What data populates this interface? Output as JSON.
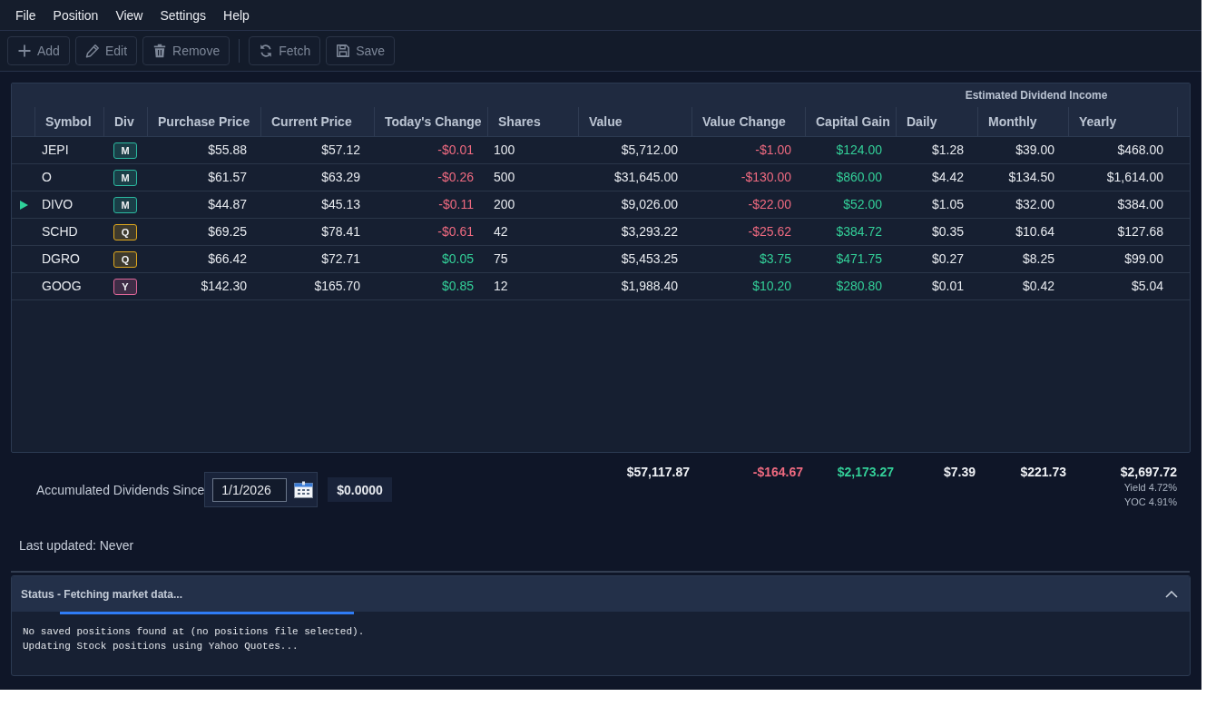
{
  "menu": [
    {
      "label": "File"
    },
    {
      "label": "Position"
    },
    {
      "label": "View"
    },
    {
      "label": "Settings"
    },
    {
      "label": "Help"
    }
  ],
  "toolbar": {
    "groups": [
      {
        "buttons": [
          {
            "label": "Add",
            "disabled": true
          },
          {
            "label": "Edit",
            "disabled": true
          },
          {
            "label": "Remove",
            "disabled": true
          }
        ]
      },
      {
        "buttons": [
          {
            "label": "Fetch",
            "disabled": true
          },
          {
            "label": "Save",
            "disabled": true
          }
        ]
      }
    ]
  },
  "table": {
    "group_header": "Estimated Dividend Income",
    "columns": [
      "Symbol",
      "Div",
      "Purchase Price",
      "Current Price",
      "Today's Change",
      "Shares",
      "Value",
      "Value Change",
      "Capital Gain",
      "Daily",
      "Monthly",
      "Yearly"
    ],
    "rows": [
      {
        "selected": false,
        "cells": [
          {
            "text": "JEPI",
            "color": "#e6e9ee"
          },
          {
            "text": "M",
            "color": "#2bb9a0"
          },
          {
            "text": "$55.88",
            "color": "#e6e9ee"
          },
          {
            "text": "$57.12",
            "color": "#e6e9ee"
          },
          {
            "text": "-$0.01",
            "color": "#ef6a80"
          },
          {
            "text": "100",
            "color": "#e6e9ee"
          },
          {
            "text": "$5,712.00",
            "color": "#e6e9ee"
          },
          {
            "text": "-$1.00",
            "color": "#ef6a80"
          },
          {
            "text": "$124.00",
            "color": "#33cf98"
          },
          {
            "text": "$1.28",
            "color": "#e6e9ee"
          },
          {
            "text": "$39.00",
            "color": "#e6e9ee"
          },
          {
            "text": "$468.00",
            "color": "#e6e9ee"
          }
        ]
      },
      {
        "selected": false,
        "cells": [
          {
            "text": "O",
            "color": "#e6e9ee"
          },
          {
            "text": "M",
            "color": "#2bb9a0"
          },
          {
            "text": "$61.57",
            "color": "#e6e9ee"
          },
          {
            "text": "$63.29",
            "color": "#e6e9ee"
          },
          {
            "text": "-$0.26",
            "color": "#ef6a80"
          },
          {
            "text": "500",
            "color": "#e6e9ee"
          },
          {
            "text": "$31,645.00",
            "color": "#e6e9ee"
          },
          {
            "text": "-$130.00",
            "color": "#ef6a80"
          },
          {
            "text": "$860.00",
            "color": "#33cf98"
          },
          {
            "text": "$4.42",
            "color": "#e6e9ee"
          },
          {
            "text": "$134.50",
            "color": "#e6e9ee"
          },
          {
            "text": "$1,614.00",
            "color": "#e6e9ee"
          }
        ]
      },
      {
        "selected": true,
        "cells": [
          {
            "text": "DIVO",
            "color": "#e6e9ee"
          },
          {
            "text": "M",
            "color": "#2bb9a0"
          },
          {
            "text": "$44.87",
            "color": "#e6e9ee"
          },
          {
            "text": "$45.13",
            "color": "#e6e9ee"
          },
          {
            "text": "-$0.11",
            "color": "#ef6a80"
          },
          {
            "text": "200",
            "color": "#e6e9ee"
          },
          {
            "text": "$9,026.00",
            "color": "#e6e9ee"
          },
          {
            "text": "-$22.00",
            "color": "#ef6a80"
          },
          {
            "text": "$52.00",
            "color": "#33cf98"
          },
          {
            "text": "$1.05",
            "color": "#e6e9ee"
          },
          {
            "text": "$32.00",
            "color": "#e6e9ee"
          },
          {
            "text": "$384.00",
            "color": "#e6e9ee"
          }
        ]
      },
      {
        "selected": false,
        "cells": [
          {
            "text": "SCHD",
            "color": "#e6e9ee"
          },
          {
            "text": "Q",
            "color": "#e0a81e"
          },
          {
            "text": "$69.25",
            "color": "#e6e9ee"
          },
          {
            "text": "$78.41",
            "color": "#e6e9ee"
          },
          {
            "text": "-$0.61",
            "color": "#ef6a80"
          },
          {
            "text": "42",
            "color": "#e6e9ee"
          },
          {
            "text": "$3,293.22",
            "color": "#e6e9ee"
          },
          {
            "text": "-$25.62",
            "color": "#ef6a80"
          },
          {
            "text": "$384.72",
            "color": "#33cf98"
          },
          {
            "text": "$0.35",
            "color": "#e6e9ee"
          },
          {
            "text": "$10.64",
            "color": "#e6e9ee"
          },
          {
            "text": "$127.68",
            "color": "#e6e9ee"
          }
        ]
      },
      {
        "selected": false,
        "cells": [
          {
            "text": "DGRO",
            "color": "#e6e9ee"
          },
          {
            "text": "Q",
            "color": "#e0a81e"
          },
          {
            "text": "$66.42",
            "color": "#e6e9ee"
          },
          {
            "text": "$72.71",
            "color": "#e6e9ee"
          },
          {
            "text": "$0.05",
            "color": "#33cf98"
          },
          {
            "text": "75",
            "color": "#e6e9ee"
          },
          {
            "text": "$5,453.25",
            "color": "#e6e9ee"
          },
          {
            "text": "$3.75",
            "color": "#33cf98"
          },
          {
            "text": "$471.75",
            "color": "#33cf98"
          },
          {
            "text": "$0.27",
            "color": "#e6e9ee"
          },
          {
            "text": "$8.25",
            "color": "#e6e9ee"
          },
          {
            "text": "$99.00",
            "color": "#e6e9ee"
          }
        ]
      },
      {
        "selected": false,
        "cells": [
          {
            "text": "GOOG",
            "color": "#e6e9ee"
          },
          {
            "text": "Y",
            "color": "#e0679a"
          },
          {
            "text": "$142.30",
            "color": "#e6e9ee"
          },
          {
            "text": "$165.70",
            "color": "#e6e9ee"
          },
          {
            "text": "$0.85",
            "color": "#33cf98"
          },
          {
            "text": "12",
            "color": "#e6e9ee"
          },
          {
            "text": "$1,988.40",
            "color": "#e6e9ee"
          },
          {
            "text": "$10.20",
            "color": "#33cf98"
          },
          {
            "text": "$280.80",
            "color": "#33cf98"
          },
          {
            "text": "$0.01",
            "color": "#e6e9ee"
          },
          {
            "text": "$0.42",
            "color": "#e6e9ee"
          },
          {
            "text": "$5.04",
            "color": "#e6e9ee"
          }
        ]
      }
    ]
  },
  "footer": {
    "totals": [
      {
        "text": "$57,117.87",
        "color": "#eef0f4"
      },
      {
        "text": "-$164.67",
        "color": "#ef6a80"
      },
      {
        "text": "$2,173.27",
        "color": "#33cf98"
      },
      {
        "text": "$7.39",
        "color": "#eef0f4"
      },
      {
        "text": "$221.73",
        "color": "#eef0f4"
      },
      {
        "text": "$2,697.72",
        "color": "#eef0f4",
        "notes": [
          "Yield 4.72%",
          "YOC 4.91%"
        ]
      }
    ],
    "accumulated": {
      "label": "Accumulated Dividends Since",
      "date": "1/1/2026",
      "amount": "$0.0000"
    },
    "last_updated": "Last updated: Never"
  },
  "status": {
    "title": "Status - Fetching market data...",
    "expanded": true,
    "busy": true,
    "log": [
      "No saved positions found at (no positions file selected).",
      "Updating Stock positions using Yahoo Quotes..."
    ]
  }
}
